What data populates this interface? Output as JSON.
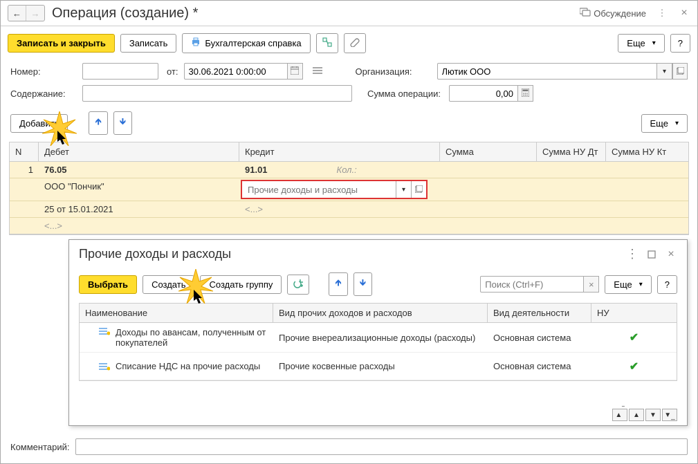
{
  "header": {
    "title": "Операция (создание) *",
    "discussion": "Обсуждение"
  },
  "toolbar": {
    "write_close": "Записать и закрыть",
    "write": "Записать",
    "accounting_ref": "Бухгалтерская справка",
    "more": "Еще",
    "help": "?"
  },
  "fields": {
    "number_label": "Номер:",
    "number_value": "",
    "from_label": "от:",
    "date_value": "30.06.2021 0:00:00",
    "org_label": "Организация:",
    "org_value": "Лютик ООО",
    "content_label": "Содержание:",
    "content_value": "",
    "sum_label": "Сумма операции:",
    "sum_value": "0,00",
    "add_button": "Добавить",
    "comment_label": "Комментарий:",
    "comment_value": ""
  },
  "table": {
    "headers": {
      "n": "N",
      "debit": "Дебет",
      "credit": "Кредит",
      "sum": "Сумма",
      "sum_nu_dt": "Сумма НУ Дт",
      "sum_nu_kt": "Сумма НУ Кт"
    },
    "row": {
      "n": "1",
      "debit_account": "76.05",
      "credit_account": "91.01",
      "qty_label": "Кол.:",
      "debit_subkonto1": "ООО \"Пончик\"",
      "credit_subkonto1_placeholder": "Прочие доходы и расходы",
      "debit_subkonto2": "25 от 15.01.2021",
      "credit_subkonto2": "<...>",
      "debit_subkonto3": "<...>"
    }
  },
  "dialog": {
    "title": "Прочие доходы и расходы",
    "select": "Выбрать",
    "create": "Создать",
    "create_group": "Создать группу",
    "search_placeholder": "Поиск (Ctrl+F)",
    "more": "Еще",
    "help": "?",
    "cols": {
      "name": "Наименование",
      "type": "Вид прочих доходов и расходов",
      "activity": "Вид деятельности",
      "nu": "НУ"
    },
    "rows": [
      {
        "name": "Доходы по авансам, полученным от покупателей",
        "type": "Прочие внереализационные доходы (расходы)",
        "activity": "Основная система",
        "nu": true
      },
      {
        "name": "Списание НДС на прочие расходы",
        "type": "Прочие косвенные расходы",
        "activity": "Основная система",
        "nu": true
      }
    ]
  }
}
